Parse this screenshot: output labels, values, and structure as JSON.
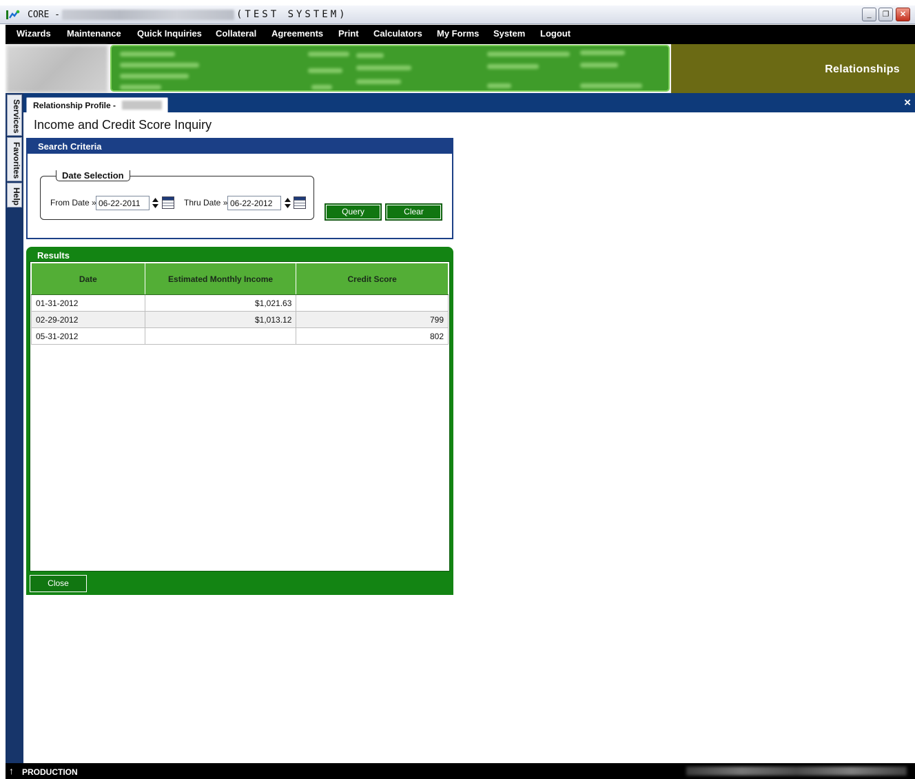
{
  "window": {
    "app_name": "CORE -",
    "system_label": "(TEST SYSTEM)",
    "controls": {
      "minimize": "_",
      "restore": "❐",
      "close": "✕"
    }
  },
  "menu": [
    "Wizards",
    "Maintenance",
    "Quick Inquiries",
    "Collateral",
    "Agreements",
    "Print",
    "Calculators",
    "My Forms",
    "System",
    "Logout"
  ],
  "banner": {
    "section_label": "Relationships"
  },
  "side_tabs": [
    "Services",
    "Favorites",
    "Help"
  ],
  "tab": {
    "label": "Relationship Profile -",
    "close": "×"
  },
  "page": {
    "title": "Income and Credit Score Inquiry"
  },
  "search": {
    "title": "Search Criteria",
    "date_selection_title": "Date Selection",
    "from_label": "From Date »",
    "from_value": "06-22-2011",
    "thru_label": "Thru Date »",
    "thru_value": "06-22-2012",
    "query_label": "Query",
    "clear_label": "Clear"
  },
  "results": {
    "title": "Results",
    "columns": [
      "Date",
      "Estimated Monthly Income",
      "Credit Score"
    ],
    "rows": [
      [
        "01-31-2012",
        "$1,021.63",
        ""
      ],
      [
        "02-29-2012",
        "$1,013.12",
        "799"
      ],
      [
        "05-31-2012",
        "",
        "802"
      ]
    ],
    "close_label": "Close"
  },
  "status": {
    "arrow": "↑",
    "environment": "PRODUCTION"
  },
  "colors": {
    "menu_bg": "#000000",
    "banner_green": "#3f9c2a",
    "banner_olive": "#6b6a14",
    "navy": "#1b3f86",
    "panel_green": "#138413",
    "header_green": "#53ae36"
  }
}
